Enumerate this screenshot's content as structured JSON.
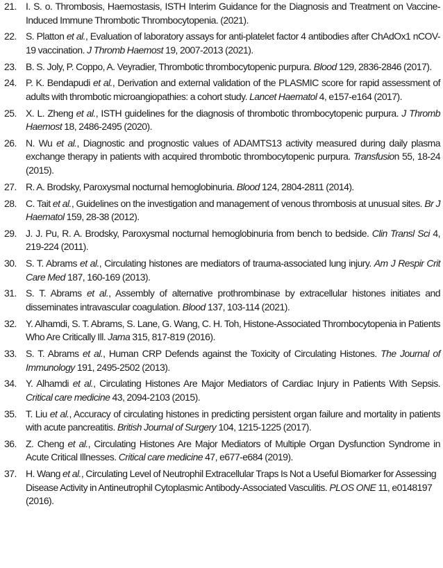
{
  "references": [
    {
      "number": "21.",
      "segments": [
        {
          "text": "I. S. o. Thrombosis, Haemostasis, ISTH Interim Guidance for the Diagnosis and Treatment on Vaccine-Induced Immune Thrombotic Thrombocytopenia. (2021)."
        }
      ]
    },
    {
      "number": "22.",
      "segments": [
        {
          "text": "S. Platton "
        },
        {
          "text": "et al.",
          "italic": true
        },
        {
          "text": ", Evaluation of laboratory assays for anti-platelet factor 4 antibodies after ChAdOx1 nCOV-19 vaccination. "
        },
        {
          "text": "J Thromb Haemost",
          "italic": true
        },
        {
          "text": " 19, 2007-2013 (2021)."
        }
      ]
    },
    {
      "number": "23.",
      "segments": [
        {
          "text": "B. S. Joly, P. Coppo, A. Veyradier, Thrombotic thrombocytopenic purpura. "
        },
        {
          "text": "Blood",
          "italic": true
        },
        {
          "text": " 129, 2836-2846 (2017)."
        }
      ]
    },
    {
      "number": "24.",
      "segments": [
        {
          "text": "P. K. Bendapudi "
        },
        {
          "text": "et al.",
          "italic": true
        },
        {
          "text": ", Derivation and external validation of the PLASMIC score for rapid assessment of adults with thrombotic microangiopathies: a cohort study. "
        },
        {
          "text": "Lancet Haematol",
          "italic": true
        },
        {
          "text": " 4, e157-e164 (2017)."
        }
      ]
    },
    {
      "number": "25.",
      "segments": [
        {
          "text": "X. L. Zheng "
        },
        {
          "text": "et al.",
          "italic": true
        },
        {
          "text": ", ISTH guidelines for the diagnosis of thrombotic thrombocytopenic purpura. "
        },
        {
          "text": "J Thromb Haemost",
          "italic": true
        },
        {
          "text": " 18, 2486-2495 (2020)."
        }
      ]
    },
    {
      "number": "26.",
      "segments": [
        {
          "text": "N. Wu "
        },
        {
          "text": "et al.",
          "italic": true
        },
        {
          "text": ", Diagnostic and prognostic values of ADAMTS13 activity measured during daily plasma exchange therapy in patients with acquired thrombotic thrombocytopenic purpura. "
        },
        {
          "text": "Transfusio",
          "italic": true
        },
        {
          "text": "n 55, 18-24 (2015)."
        }
      ]
    },
    {
      "number": "27.",
      "segments": [
        {
          "text": "R. A. Brodsky, Paroxysmal nocturnal hemoglobinuria. "
        },
        {
          "text": "Blood",
          "italic": true
        },
        {
          "text": " 124, 2804-2811 (2014)."
        }
      ]
    },
    {
      "number": "28.",
      "segments": [
        {
          "text": "C. Tait "
        },
        {
          "text": "et al.",
          "italic": true
        },
        {
          "text": ", Guidelines on the investigation and management of venous thrombosis at unusual sites. "
        },
        {
          "text": "Br J Haematol",
          "italic": true
        },
        {
          "text": " 159, 28-38 (2012)."
        }
      ]
    },
    {
      "number": "29.",
      "segments": [
        {
          "text": "J. J. Pu, R. A. Brodsky, Paroxysmal nocturnal hemoglobinuria from bench to bedside. "
        },
        {
          "text": "Clin Transl Sci",
          "italic": true
        },
        {
          "text": " 4, 219-224 (2011)."
        }
      ]
    },
    {
      "number": "30.",
      "segments": [
        {
          "text": "S. T. Abrams "
        },
        {
          "text": "et al.",
          "italic": true
        },
        {
          "text": ", Circulating histones are mediators of trauma-associated lung injury. "
        },
        {
          "text": "Am J Respir Crit Care Med",
          "italic": true
        },
        {
          "text": " 187, 160-169 (2013)."
        }
      ]
    },
    {
      "number": "31.",
      "segments": [
        {
          "text": "S. T. Abrams "
        },
        {
          "text": "et al.",
          "italic": true
        },
        {
          "text": ", Assembly of alternative prothrombinase by extracellular histones initiates and disseminates intravascular coagulation. "
        },
        {
          "text": "Blood",
          "italic": true
        },
        {
          "text": " 137, 103-114 (2021)."
        }
      ]
    },
    {
      "number": "32.",
      "segments": [
        {
          "text": "Y. Alhamdi, S. T. Abrams, S. Lane, G. Wang, C. H. Toh, Histone-Associated Thrombocytopenia in Patients Who Are Critically Ill. "
        },
        {
          "text": "Jama",
          "italic": true
        },
        {
          "text": " 315, 817-819 (2016)."
        }
      ]
    },
    {
      "number": "33.",
      "segments": [
        {
          "text": "S. T. Abrams "
        },
        {
          "text": "et al.",
          "italic": true
        },
        {
          "text": ", Human CRP Defends against the Toxicity of Circulating Histones. "
        },
        {
          "text": "The Journal of Immunology",
          "italic": true
        },
        {
          "text": " 191, 2495-2502 (2013)."
        }
      ]
    },
    {
      "number": "34.",
      "segments": [
        {
          "text": "Y. Alhamdi "
        },
        {
          "text": "et al.",
          "italic": true
        },
        {
          "text": ", Circulating Histones Are Major Mediators of Cardiac Injury in Patients With Sepsis. "
        },
        {
          "text": "Critical care medicine",
          "italic": true
        },
        {
          "text": " 43, 2094-2103 (2015)."
        }
      ]
    },
    {
      "number": "35.",
      "segments": [
        {
          "text": "T. Liu "
        },
        {
          "text": "et al.",
          "italic": true
        },
        {
          "text": ", Accuracy of circulating histones in predicting persistent organ failure and mortality in patients with acute pancreatitis. "
        },
        {
          "text": "British Journal of Surgery",
          "italic": true
        },
        {
          "text": " 104, 1215-1225 (2017)."
        }
      ]
    },
    {
      "number": "36.",
      "segments": [
        {
          "text": "Z. Cheng "
        },
        {
          "text": "et al.",
          "italic": true
        },
        {
          "text": ", Circulating Histones Are Major Mediators of Multiple Organ Dysfunction Syndrome in Acute Critical Illnesses. "
        },
        {
          "text": "Critical care medicine",
          "italic": true
        },
        {
          "text": " 47, e677-e684 (2019)."
        }
      ]
    },
    {
      "number": "37.",
      "segments": [
        {
          "text": "H. Wang "
        },
        {
          "text": "et al.",
          "italic": true
        },
        {
          "text": ", Circulating Level of Neutrophil Extracellular Traps Is Not a Useful Biomarker for Assessing Disease Activity in Antineutrophil Cytoplasmic Antibody-Associated Vasculitis. "
        },
        {
          "text": "PLOS ONE",
          "italic": true
        },
        {
          "text": " 11, e0148197 (2016)."
        }
      ]
    }
  ]
}
